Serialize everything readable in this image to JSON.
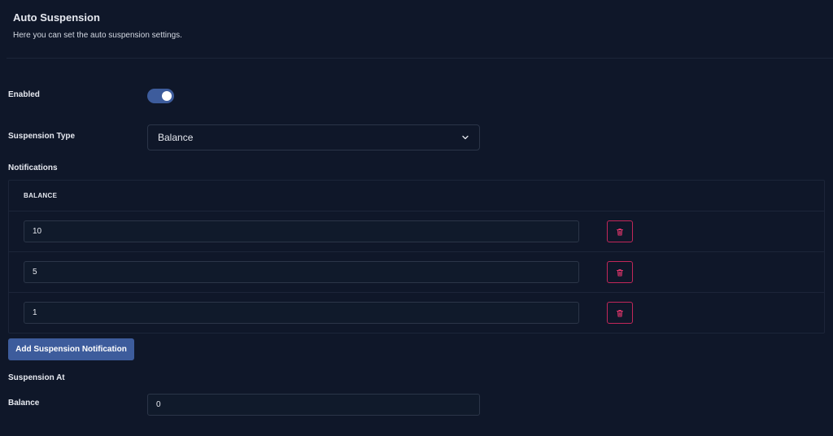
{
  "header": {
    "title": "Auto Suspension",
    "subtitle": "Here you can set the auto suspension settings."
  },
  "enabled": {
    "label": "Enabled",
    "value": true
  },
  "suspension_type": {
    "label": "Suspension Type",
    "selected": "Balance"
  },
  "notifications": {
    "label": "Notifications",
    "column_header": "BALANCE",
    "rows": [
      {
        "value": "10"
      },
      {
        "value": "5"
      },
      {
        "value": "1"
      }
    ],
    "add_button_label": "Add Suspension Notification"
  },
  "suspension_at": {
    "label": "Suspension At",
    "balance_label": "Balance",
    "balance_value": "0"
  },
  "colors": {
    "background": "#0f1729",
    "accent": "#3d5c9c",
    "danger": "#c2275a"
  },
  "icons": {
    "dropdown": "chevron-down-icon",
    "delete": "trash-icon"
  }
}
